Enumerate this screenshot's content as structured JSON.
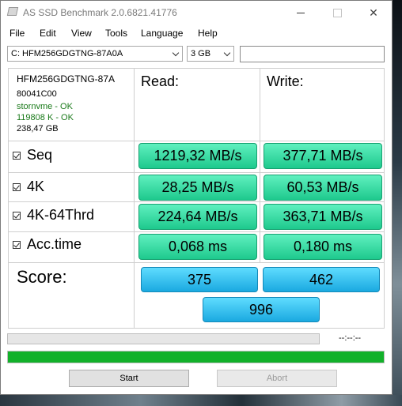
{
  "window": {
    "title": "AS SSD Benchmark 2.0.6821.41776"
  },
  "menu": [
    "File",
    "Edit",
    "View",
    "Tools",
    "Language",
    "Help"
  ],
  "toolbar": {
    "drive": "C: HFM256GDGTNG-87A0A",
    "size": "3 GB",
    "text_field": ""
  },
  "info": {
    "model": "HFM256GDGTNG-87A",
    "firmware": "80041C00",
    "driver": "stornvme - OK",
    "alignment": "119808 K - OK",
    "capacity": "238,47 GB"
  },
  "headers": {
    "read": "Read:",
    "write": "Write:"
  },
  "rows": [
    {
      "label": "Seq",
      "checked": true,
      "read": "1219,32 MB/s",
      "write": "377,71 MB/s"
    },
    {
      "label": "4K",
      "checked": true,
      "read": "28,25 MB/s",
      "write": "60,53 MB/s"
    },
    {
      "label": "4K-64Thrd",
      "checked": true,
      "read": "224,64 MB/s",
      "write": "363,71 MB/s"
    },
    {
      "label": "Acc.time",
      "checked": true,
      "read": "0,068 ms",
      "write": "0,180 ms"
    }
  ],
  "score": {
    "label": "Score:",
    "read": "375",
    "write": "462",
    "total": "996"
  },
  "status": {
    "elapsed": "--:--:--",
    "progress_fraction": 1.0
  },
  "buttons": {
    "start": "Start",
    "abort": "Abort"
  },
  "colors": {
    "result_green": "#1ec98d",
    "score_blue": "#1aa9e0",
    "progress_green": "#12b12a",
    "ok_text": "#1a7a1a"
  }
}
